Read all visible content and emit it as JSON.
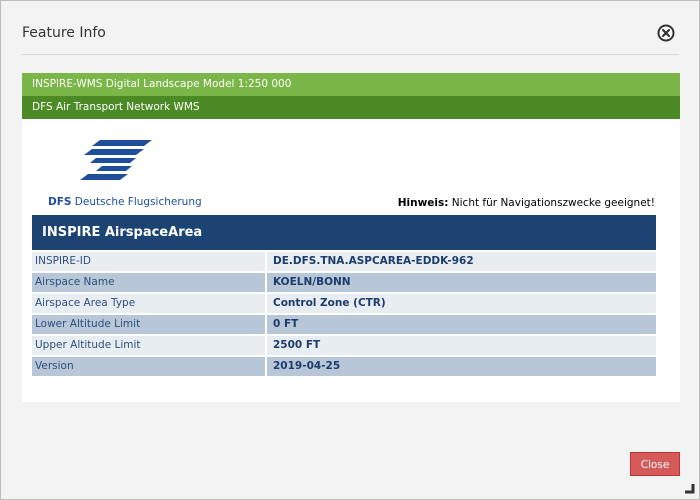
{
  "dialog": {
    "title": "Feature Info",
    "close_icon": "close-circle-icon",
    "resize_icon": "resize-handle-icon",
    "close_button": "Close"
  },
  "tabs": [
    {
      "label": "INSPIRE-WMS Digital Landscape Model 1:250 000"
    },
    {
      "label": "DFS Air Transport Network WMS"
    }
  ],
  "logo": {
    "abbr": "DFS",
    "name": "Deutsche Flugsicherung"
  },
  "notice": {
    "label": "Hinweis:",
    "text": "Nicht für Navigationszwecke geeignet!"
  },
  "table": {
    "title": "INSPIRE AirspaceArea",
    "rows": [
      {
        "label": "INSPIRE-ID",
        "value": "DE.DFS.TNA.ASPCAREA-EDDK-962"
      },
      {
        "label": "Airspace Name",
        "value": "KOELN/BONN"
      },
      {
        "label": "Airspace Area Type",
        "value": "Control Zone (CTR)"
      },
      {
        "label": "Lower Altitude Limit",
        "value": "0 FT"
      },
      {
        "label": "Upper Altitude Limit",
        "value": "2500 FT"
      },
      {
        "label": "Version",
        "value": "2019-04-25"
      }
    ]
  },
  "colors": {
    "tab_active": "#7ab648",
    "tab_secondary": "#4c8a26",
    "table_header": "#1c4372",
    "close_button": "#d65a5a"
  }
}
